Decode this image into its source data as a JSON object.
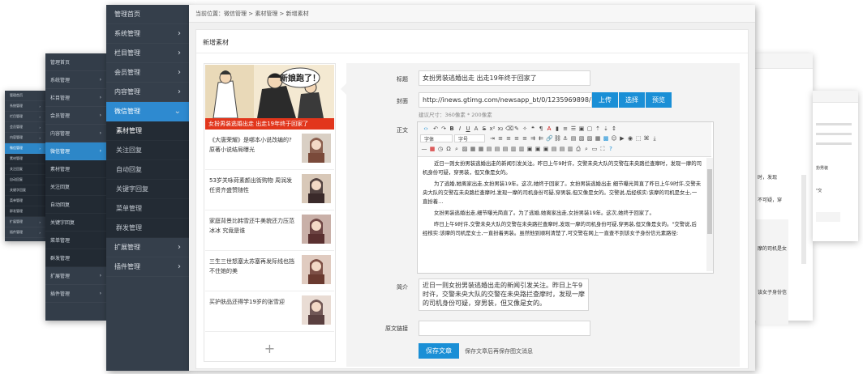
{
  "back_layer_far": {
    "items": [
      "管理首页",
      "系统管理",
      "栏目管理",
      "会员管理",
      "内容管理",
      "微信管理",
      "素材管理",
      "关注回复",
      "自动回复",
      "关键字回复",
      "菜单管理",
      "群发管理",
      "扩展管理",
      "插件管理"
    ]
  },
  "back_layer_mid": {
    "items": [
      "管理首页",
      "系统管理",
      "栏目管理",
      "会员管理",
      "内容管理",
      "微信管理",
      "素材管理",
      "关注回复",
      "自动回复",
      "关键字回复",
      "菜单管理",
      "群发管理",
      "扩展管理",
      "插件管理"
    ]
  },
  "sidebar": {
    "items": [
      {
        "label": "管理首页",
        "chevron": false
      },
      {
        "label": "系统管理",
        "chevron": true
      },
      {
        "label": "栏目管理",
        "chevron": true
      },
      {
        "label": "会员管理",
        "chevron": true
      },
      {
        "label": "内容管理",
        "chevron": true
      },
      {
        "label": "微信管理",
        "chevron": true,
        "active": true
      },
      {
        "label": "素材管理",
        "sub": true,
        "current": true
      },
      {
        "label": "关注回复",
        "sub": true
      },
      {
        "label": "自动回复",
        "sub": true
      },
      {
        "label": "关键字回复",
        "sub": true
      },
      {
        "label": "菜单管理",
        "sub": true
      },
      {
        "label": "群发管理",
        "sub": true
      },
      {
        "label": "扩展管理",
        "chevron": true
      },
      {
        "label": "插件管理",
        "chevron": true
      }
    ]
  },
  "breadcrumb": "当前位置：微信管理 > 素材管理 > 新增素材",
  "card_title": "新增素材",
  "cover": {
    "caption": "女扮男装逃婚出走 出走19年终于回家了",
    "bubble": "新娘跑了！"
  },
  "articles": [
    {
      "title": "《大唐荣耀》是哪本小说改编的?原著小说结局曝光"
    },
    {
      "title": "53岁关咏荷素颜出街购物 周润发任贤齐盛赞随性"
    },
    {
      "title": "家庭背景比韩雪还牛美貌还力压范冰冰 究竟是谁"
    },
    {
      "title": "三生三世怒塞太苏塞再发际线也挡不住她的美"
    },
    {
      "title": "买护肤品还得学19岁的张雪迎"
    }
  ],
  "add_label": "+",
  "form": {
    "title_label": "标题",
    "title_value": "女扮男装逃婚出走 出走19年终于回家了",
    "cover_label": "封面",
    "cover_value": "http://inews.gtimg.com/newsapp_bt/0/1235969898/",
    "upload_btn": "上传",
    "choose_btn": "选择",
    "preview_btn": "预览",
    "cover_hint": "建议尺寸：360像素 * 200像素",
    "body_label": "正文",
    "font_select": "字体",
    "size_select": "字号",
    "body_paragraphs": [
      "近日一则女扮男装逃婚出走的新闻引发关注。昨日上午9时许，交警未央大队的交警在未央路拦查摩时，发现一摩的司机身份可疑，穿男装，但又像是女的。",
      "为了逃婚,她离家出走,女扮男装19年。这次,她终于回家了。女扮男装逃婚出走 细节曝光简直了昨日上午9时许,交警未央大队的交警在未央路拦查摩时,发现一摩的司机身份可疑,穿男装,但又像是女的。交警说,后经核实:该摩的司机是女士,一直扮着…",
      "女扮男装逃婚出走,细节曝光简直了。为了逃婚,她离家出走,女扮男装19年。这次,她终于回家了。",
      "昨日上午9时许,交警未央大队的交警在未央路拦查摩时,发现一摩的司机身份可疑,穿男装,但又像是女的。\"交警说,后经核实:该摩的司机是女士,一直扮着男装。虽然他到顺利清楚了,可交警在网上一直查不到该女子身份信元素路径:"
    ],
    "summary_label": "简介",
    "summary_value": "近日一则女扮男装逃婚出走的新闻引发关注。昨日上午9时许，交警未央大队的交警在未央路拦查摩时，发现一摩的司机身份可疑，穿男装，但又像是女的。",
    "link_label": "原文链接",
    "link_value": "",
    "save_btn": "保存文章",
    "save_hint": "保存文章后再保存图文消息"
  },
  "right_layer": {
    "snippets": [
      "时，发现",
      "不可疑，穿",
      "摩的司机是女",
      "该女子身份信",
      "扮男装",
      "\"交"
    ]
  },
  "colors": {
    "accent": "#2e8ad0",
    "sidebar": "#353f4b",
    "cover_caption": "#e2361c"
  }
}
